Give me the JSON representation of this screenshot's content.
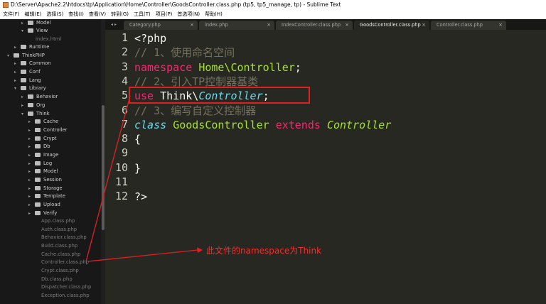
{
  "window": {
    "title": "D:\\Server\\Apache2.2\\htdocs\\tp\\Application\\Home\\Controller\\GoodsController.class.php (tp5, tp5_manage, tp) - Sublime Text"
  },
  "menu": [
    "文件(F)",
    "编辑(E)",
    "选择(S)",
    "查找(I)",
    "查看(V)",
    "转到(G)",
    "工具(T)",
    "项目(P)",
    "首选项(N)",
    "帮助(H)"
  ],
  "sidebar": {
    "items": [
      {
        "label": "Model",
        "type": "folder",
        "state": "collapsed"
      },
      {
        "label": "View",
        "type": "folder",
        "state": "expanded"
      },
      {
        "label": "index.html",
        "type": "file"
      },
      {
        "label": "Runtime",
        "type": "folder",
        "state": "collapsed"
      },
      {
        "label": "ThinkPHP",
        "type": "folder",
        "state": "expanded"
      },
      {
        "label": "Common",
        "type": "folder",
        "state": "collapsed"
      },
      {
        "label": "Conf",
        "type": "folder",
        "state": "collapsed"
      },
      {
        "label": "Lang",
        "type": "folder",
        "state": "collapsed"
      },
      {
        "label": "Library",
        "type": "folder",
        "state": "expanded"
      },
      {
        "label": "Behavior",
        "type": "folder",
        "state": "collapsed"
      },
      {
        "label": "Org",
        "type": "folder",
        "state": "collapsed"
      },
      {
        "label": "Think",
        "type": "folder",
        "state": "expanded"
      },
      {
        "label": "Cache",
        "type": "folder",
        "state": "collapsed"
      },
      {
        "label": "Controller",
        "type": "folder",
        "state": "collapsed"
      },
      {
        "label": "Crypt",
        "type": "folder",
        "state": "collapsed"
      },
      {
        "label": "Db",
        "type": "folder",
        "state": "collapsed"
      },
      {
        "label": "Image",
        "type": "folder",
        "state": "collapsed"
      },
      {
        "label": "Log",
        "type": "folder",
        "state": "collapsed"
      },
      {
        "label": "Model",
        "type": "folder",
        "state": "collapsed"
      },
      {
        "label": "Session",
        "type": "folder",
        "state": "collapsed"
      },
      {
        "label": "Storage",
        "type": "folder",
        "state": "collapsed"
      },
      {
        "label": "Template",
        "type": "folder",
        "state": "collapsed"
      },
      {
        "label": "Upload",
        "type": "folder",
        "state": "collapsed"
      },
      {
        "label": "Verify",
        "type": "folder",
        "state": "collapsed"
      },
      {
        "label": "App.class.php",
        "type": "file"
      },
      {
        "label": "Auth.class.php",
        "type": "file"
      },
      {
        "label": "Behavior.class.php",
        "type": "file"
      },
      {
        "label": "Build.class.php",
        "type": "file"
      },
      {
        "label": "Cache.class.php",
        "type": "file"
      },
      {
        "label": "Controller.class.php",
        "type": "file"
      },
      {
        "label": "Crypt.class.php",
        "type": "file"
      },
      {
        "label": "Db.class.php",
        "type": "file"
      },
      {
        "label": "Dispatcher.class.php",
        "type": "file"
      },
      {
        "label": "Exception.class.php",
        "type": "file"
      }
    ]
  },
  "tabs": {
    "nav_glyph": "◂ ▸",
    "close_glyph": "×",
    "items": [
      {
        "label": "Category.php",
        "active": false
      },
      {
        "label": "index.php",
        "active": false
      },
      {
        "label": "IndexController.class.php",
        "active": false
      },
      {
        "label": "GoodsController.class.php",
        "active": true
      },
      {
        "label": "Controller.class.php",
        "active": false
      }
    ]
  },
  "code": {
    "line_numbers": [
      "1",
      "2",
      "3",
      "4",
      "5",
      "6",
      "7",
      "8",
      "9",
      "10",
      "11",
      "12"
    ],
    "lines": [
      [
        {
          "t": "<?php",
          "c": "plain"
        }
      ],
      [
        {
          "t": "// 1、使用命名空间",
          "c": "cm"
        }
      ],
      [
        {
          "t": "namespace ",
          "c": "kw"
        },
        {
          "t": "Home\\Controller",
          "c": "cls"
        },
        {
          "t": ";",
          "c": "plain"
        }
      ],
      [
        {
          "t": "// 2、引入TP控制器基类",
          "c": "cm"
        }
      ],
      [
        {
          "t": "use ",
          "c": "kw"
        },
        {
          "t": "Think\\",
          "c": "plain"
        },
        {
          "t": "Controller",
          "c": "it"
        },
        {
          "t": ";",
          "c": "plain"
        }
      ],
      [
        {
          "t": "// 3、编写自定义控制器",
          "c": "cm"
        }
      ],
      [
        {
          "t": "class ",
          "c": "it"
        },
        {
          "t": "GoodsController ",
          "c": "cls"
        },
        {
          "t": "extends ",
          "c": "kw"
        },
        {
          "t": "Controller",
          "c": "it2"
        }
      ],
      [
        {
          "t": "{",
          "c": "plain"
        }
      ],
      [],
      [
        {
          "t": "}",
          "c": "plain"
        }
      ],
      [],
      [
        {
          "t": "?>",
          "c": "plain"
        }
      ]
    ]
  },
  "annotation": {
    "text": "此文件的namespace为Think",
    "color": "#ff2a2a"
  },
  "colors": {
    "editor_bg": "#272822",
    "sidebar_bg": "#181818",
    "keyword": "#f92672",
    "class_name": "#a6e22e",
    "storage": "#66d9ef",
    "comment": "#75715e"
  }
}
